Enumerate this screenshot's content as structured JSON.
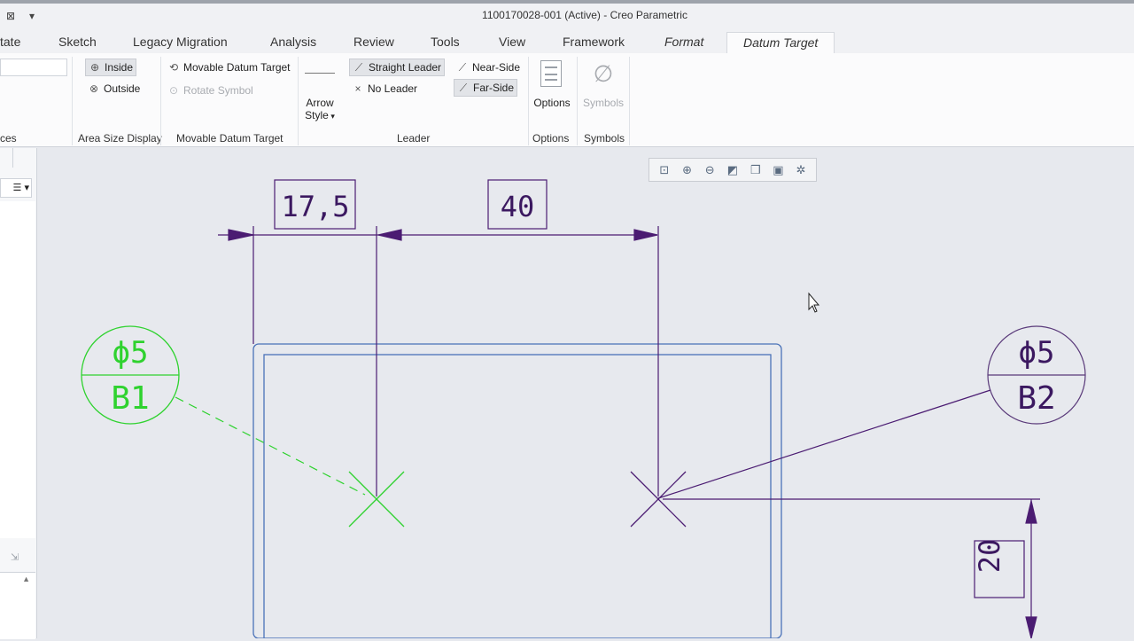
{
  "window": {
    "title": "1100170028-001 (Active) - Creo Parametric",
    "quick_icons": [
      "close-x-icon",
      "dropdown-arrow-icon"
    ]
  },
  "tabs": [
    {
      "label": "tate"
    },
    {
      "label": "Sketch"
    },
    {
      "label": "Legacy Migration"
    },
    {
      "label": "Analysis"
    },
    {
      "label": "Review"
    },
    {
      "label": "Tools"
    },
    {
      "label": "View"
    },
    {
      "label": "Framework"
    },
    {
      "label": "Format"
    },
    {
      "label": "Datum Target"
    }
  ],
  "ribbon": {
    "groups": {
      "references": "ces",
      "area_size_display": "Area Size Display",
      "movable_datum_target": "Movable Datum Target",
      "leader": "Leader",
      "options": "Options",
      "symbols": "Symbols"
    },
    "area_size": {
      "inside": "Inside",
      "outside": "Outside"
    },
    "movable": {
      "movable": "Movable Datum Target",
      "rotate": "Rotate Symbol"
    },
    "arrow_style": {
      "line1": "Arrow",
      "line2": "Style"
    },
    "leader": {
      "straight": "Straight Leader",
      "no_leader": "No Leader",
      "near_side": "Near-Side",
      "far_side": "Far-Side"
    },
    "options_btn": "Options",
    "symbols_btn": "Symbols"
  },
  "drawing": {
    "dim_17_5": "17,5",
    "dim_40": "40",
    "dim_20": "20",
    "target_b1": {
      "size": "ϕ5",
      "label": "B1"
    },
    "target_b2": {
      "size": "ϕ5",
      "label": "B2"
    },
    "colors": {
      "outline": "#4a72b8",
      "dims": "#4b1c72",
      "selected": "#2fd22f"
    }
  },
  "view_toolbar": [
    "refit-icon",
    "zoom-in-icon",
    "zoom-out-icon",
    "repaint-icon",
    "orient-icon",
    "saved-views-icon",
    "display-toggle-icon"
  ]
}
